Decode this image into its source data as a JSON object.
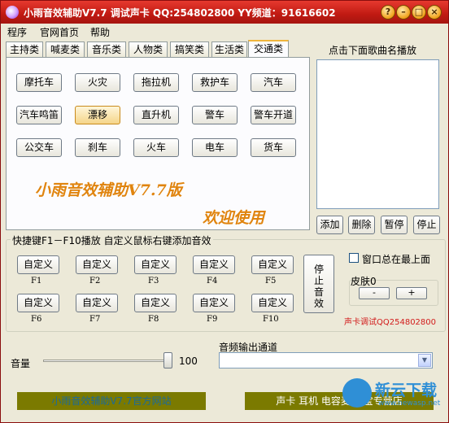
{
  "window": {
    "title": "小雨音效辅助V7.7 调试声卡 QQ:254802800   YY频道：91616602",
    "controls": [
      "?",
      "–",
      "□",
      "×"
    ]
  },
  "menu": [
    "程序",
    "官网首页",
    "帮助"
  ],
  "tabs": [
    "主持类",
    "喊麦类",
    "音乐类",
    "人物类",
    "搞笑类",
    "生活类",
    "交通类"
  ],
  "active_tab": "交通类",
  "sound_buttons": [
    [
      "摩托车",
      "火灾",
      "拖拉机",
      "救护车",
      "汽车"
    ],
    [
      "汽车鸣笛",
      "漂移",
      "直升机",
      "警车",
      "警车开道"
    ],
    [
      "公交车",
      "刹车",
      "火车",
      "电车",
      "货车"
    ]
  ],
  "focused_button": "漂移",
  "promo": {
    "line1": "小雨音效辅助V7.7版",
    "line2": "欢迎使用"
  },
  "song_panel": {
    "title": "点击下面歌曲名播放",
    "buttons": [
      "添加",
      "删除",
      "暂停",
      "停止"
    ]
  },
  "hotkeys": {
    "label": "快捷键F1－F10播放   自定义鼠标右键添加音效",
    "custom_label": "自定义",
    "keys": [
      "F1",
      "F2",
      "F3",
      "F4",
      "F5",
      "F6",
      "F7",
      "F8",
      "F9",
      "F10"
    ],
    "stop_label": "停止音效"
  },
  "options": {
    "topmost_label": "窗口总在最上面",
    "topmost_checked": false,
    "skin_label": "皮肤0",
    "skin_minus": "-",
    "skin_plus": "+"
  },
  "note": "声卡调试QQ254802800",
  "volume": {
    "label": "音量",
    "value": "100"
  },
  "audio_output": {
    "label": "音频输出通道",
    "value": ""
  },
  "bottom_bar": {
    "left": "小雨音效辅助V7.7官方网站",
    "right": "声卡 耳机 电容麦 淘宝专营店"
  },
  "watermark": {
    "text": "新云下载",
    "url": "www.newasp.net"
  },
  "colors": {
    "title_bar": "#c41c13",
    "promo": "#e0840e",
    "note": "#d21b1b",
    "bottom_bar": "#7b7a00"
  }
}
